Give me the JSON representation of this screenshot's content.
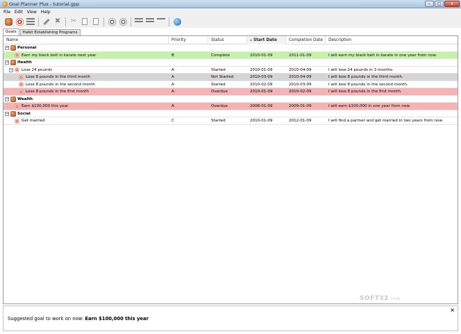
{
  "window": {
    "title": "Goal Planner Plus - tutorial.gpp",
    "min_label": "–",
    "max_label": "□",
    "close_label": "x"
  },
  "menu": [
    "File",
    "Edit",
    "View",
    "Help"
  ],
  "toolbar": [
    {
      "name": "add-goal-button",
      "icon": "goal-icon"
    },
    {
      "name": "add-target-button",
      "icon": "target-icon"
    },
    {
      "name": "add-list-button",
      "icon": "list-icon"
    },
    {
      "name": "edit-button",
      "icon": "pencil-icon"
    },
    {
      "name": "delete-button",
      "icon": "delete-icon"
    },
    {
      "name": "cut-button",
      "icon": "scissors-icon"
    },
    {
      "name": "copy-button",
      "icon": "copy-icon"
    },
    {
      "name": "paste-button",
      "icon": "paste-icon"
    },
    {
      "name": "expand-button",
      "icon": "target-gray-icon"
    },
    {
      "name": "collapse-button",
      "icon": "target-gray-icon"
    },
    {
      "name": "view-list-button",
      "icon": "rows-icon"
    },
    {
      "name": "view-detail-button",
      "icon": "rows-icon"
    },
    {
      "name": "view-compact-button",
      "icon": "rows-icon"
    },
    {
      "name": "help-button",
      "icon": "globe-icon"
    }
  ],
  "tabs": [
    "Goals",
    "Habit Establishing Programs"
  ],
  "columns": [
    "Name",
    "Priority",
    "Status",
    "Start Date",
    "Completion Date",
    "Description"
  ],
  "sort_indicator": "▵",
  "rows": [
    {
      "type": "group",
      "level": 0,
      "name": "Personal",
      "expander": "−"
    },
    {
      "type": "item",
      "level": 1,
      "style": "green",
      "name": "Earn my black belt in karate next year",
      "priority": "B",
      "status": "Complete",
      "start": "2010-01-09",
      "completion": "2011-01-09",
      "description": "I will earn my black belt in karate in one year from now."
    },
    {
      "type": "group",
      "level": 0,
      "name": "Health",
      "expander": "−"
    },
    {
      "type": "item",
      "level": 1,
      "style": "",
      "expander": "−",
      "name": "Lose 24 pounds",
      "priority": "A",
      "status": "Started",
      "start": "2010-01-09",
      "completion": "2010-04-09",
      "description": "I will lose 24 pounds in 3 months."
    },
    {
      "type": "item",
      "level": 2,
      "style": "gray",
      "name": "Lose 8 pounds in the third month",
      "priority": "A",
      "status": "Not Started",
      "start": "2010-03-09",
      "completion": "2010-04-09",
      "description": "I will lose 8 pounds in the third month."
    },
    {
      "type": "item",
      "level": 2,
      "style": "",
      "name": "Lose 8 pounds in the second month",
      "priority": "A",
      "status": "Started",
      "start": "2010-02-09",
      "completion": "2010-03-09",
      "description": "I will lose 8 pounds in the second month."
    },
    {
      "type": "item",
      "level": 2,
      "style": "red",
      "name": "Lose 8 pounds in the first month",
      "priority": "A",
      "status": "Overdue",
      "start": "2010-01-09",
      "completion": "2010-02-09",
      "description": "I will lose 8 pounds in the first month."
    },
    {
      "type": "group",
      "level": 0,
      "name": "Wealth",
      "expander": "−"
    },
    {
      "type": "item",
      "level": 1,
      "style": "red",
      "name": "Earn $100,000 this year",
      "priority": "A",
      "status": "Overdue",
      "start": "2008-01-09",
      "completion": "2009-01-09",
      "description": "I will earn $100,000 in one year from now."
    },
    {
      "type": "group",
      "level": 0,
      "name": "Social",
      "expander": "−"
    },
    {
      "type": "item",
      "level": 1,
      "style": "",
      "name": "Get married",
      "priority": "C",
      "status": "Started",
      "start": "2010-01-09",
      "completion": "2012-01-09",
      "description": "I will find a partner and get married in two years from now."
    }
  ],
  "suggestion": {
    "prefix": "Suggested goal to work on now:",
    "goal": "Earn $100,000 this year",
    "close_label": "×"
  },
  "watermark": {
    "brand": "SOFT32",
    "suffix": ".com"
  }
}
